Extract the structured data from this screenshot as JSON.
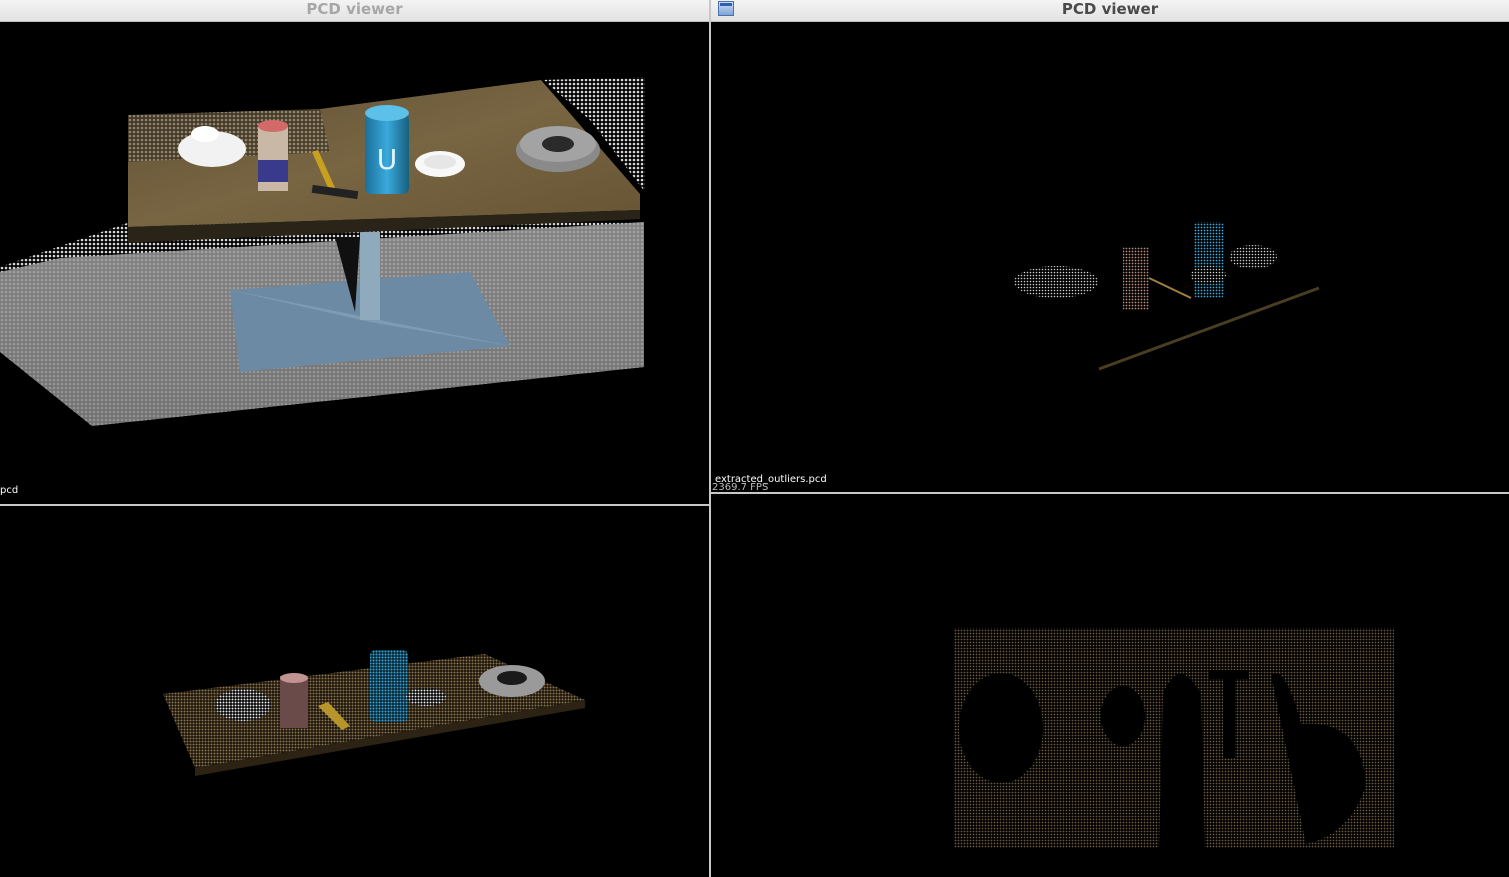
{
  "windows": {
    "top_left": {
      "title": "PCD viewer",
      "filename": "pcd"
    },
    "top_right": {
      "title": "PCD viewer",
      "filename": "extracted_outliers.pcd",
      "fps": "2369.7 FPS"
    },
    "bottom_left": {},
    "bottom_right": {}
  },
  "icons": {
    "window_icon": "window-icon"
  },
  "colors": {
    "background": "#000000",
    "separator": "#c8c8c8",
    "table": "#6e5c3a",
    "can": "#2a8fbf"
  }
}
